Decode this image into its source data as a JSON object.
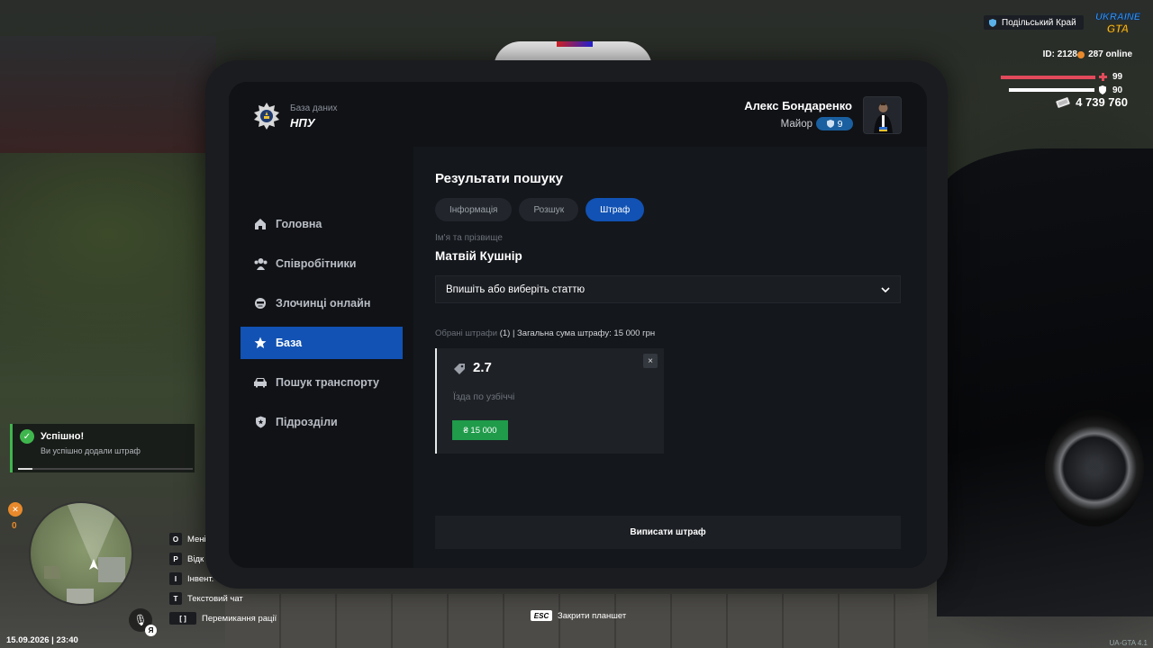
{
  "tablet": {
    "logo_sub": "База даних",
    "logo_title": "НПУ",
    "nav": [
      {
        "label": "Головна",
        "icon": "home-icon",
        "active": false
      },
      {
        "label": "Співробітники",
        "icon": "employees-icon",
        "active": false
      },
      {
        "label": "Злочинці онлайн",
        "icon": "criminal-icon",
        "active": false
      },
      {
        "label": "База",
        "icon": "star-icon",
        "active": true
      },
      {
        "label": "Пошук транспорту",
        "icon": "car-icon",
        "active": false
      },
      {
        "label": "Підрозділи",
        "icon": "badge-icon",
        "active": false
      }
    ],
    "user": {
      "name": "Алекс Бондаренко",
      "rank": "Майор",
      "level": "9"
    },
    "title": "Результати пошуку",
    "tabs": [
      {
        "label": "Інформація",
        "active": false
      },
      {
        "label": "Розшук",
        "active": false
      },
      {
        "label": "Штраф",
        "active": true
      }
    ],
    "name_label": "Ім'я та прізвище",
    "name_value": "Матвій Кушнір",
    "select_placeholder": "Впишіть або виберіть статтю",
    "summary": {
      "prefix": "Обрані штрафи",
      "count": "(1) | Загальна сума штрафу: 15 000 грн"
    },
    "fine": {
      "code": "2.7",
      "description": "Їзда по узбіччі",
      "amount": "₴ 15 000",
      "close": "×"
    },
    "submit_label": "Виписати штраф"
  },
  "hud": {
    "region": "Подільський Край",
    "logo_top": "UKRAINE",
    "logo_bottom": "GTA",
    "id": "ID: 2128",
    "online": "287 online",
    "hp": "99",
    "armor": "90",
    "money": "4 739 760",
    "hp_fill_percent": 99,
    "armor_fill_percent": 90,
    "food": "0",
    "datetime": "15.09.2026 | 23:40",
    "mic_badge": "Я",
    "keys": [
      {
        "key": "O",
        "label": "Мені"
      },
      {
        "key": "P",
        "label": "Відк"
      },
      {
        "key": "I",
        "label": "Інвент."
      },
      {
        "key": "T",
        "label": "Текстовий чат"
      },
      {
        "key": "[ ]",
        "label": "Перемикання рації"
      }
    ],
    "esc_key": "ESC",
    "esc_label": "Закрити планшет",
    "version": "UA-GTA 4.1"
  },
  "toast": {
    "title": "Успішно!",
    "text": "Ви успішно додали штраф",
    "progress_percent": 8
  },
  "colors": {
    "accent": "#1152b4",
    "success": "#3fb64d",
    "fine_amount": "#1f9b4a",
    "hp": "#e24a5b"
  }
}
